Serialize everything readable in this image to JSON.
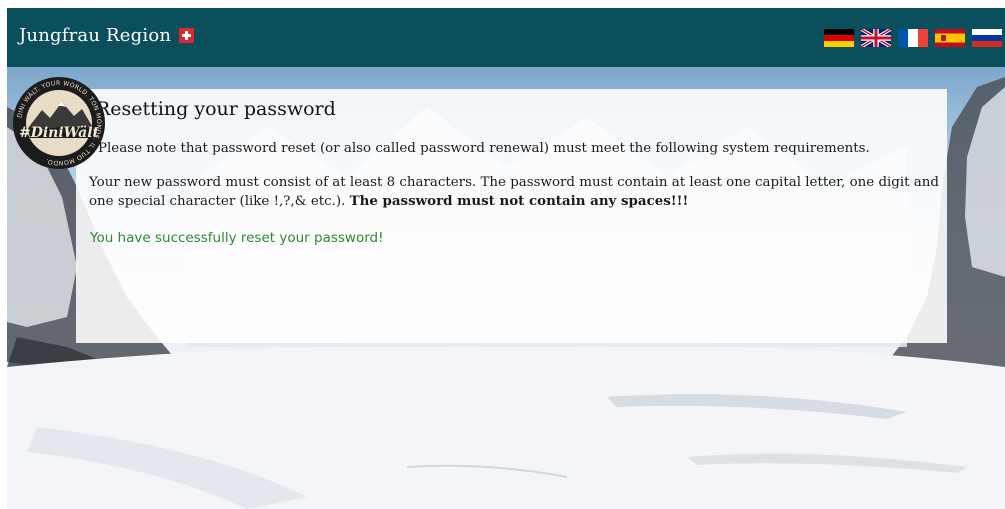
{
  "header": {
    "brand": "Jungfrau Region",
    "background_color": "#0b4f5c",
    "flag_icon": "swiss-flag-icon",
    "languages": [
      {
        "code": "de",
        "icon": "german-flag-icon"
      },
      {
        "code": "en",
        "icon": "uk-flag-icon"
      },
      {
        "code": "fr",
        "icon": "french-flag-icon"
      },
      {
        "code": "es",
        "icon": "spanish-flag-icon"
      },
      {
        "code": "ru",
        "icon": "russian-flag-icon"
      }
    ]
  },
  "badge": {
    "name": "#DiniWält",
    "ring_text": "DINI WÄLT. YOUR WORLD. TON MONDE. IL TUO MONDO.",
    "icon": "mountain-badge-icon"
  },
  "content": {
    "title": "Resetting your password",
    "paragraph_1": "Please note that password reset (or also called password renewal) must meet the following system requirements.",
    "paragraph_2": "Your new password must consist of at least 8 characters. The password must contain at least one capital letter, one digit and one special character (like !,?,& etc.).",
    "paragraph_2_bold": "The password must not contain any spaces!!!",
    "success_message": "You have successfully reset your password!",
    "success_color": "#2e8b2e"
  }
}
